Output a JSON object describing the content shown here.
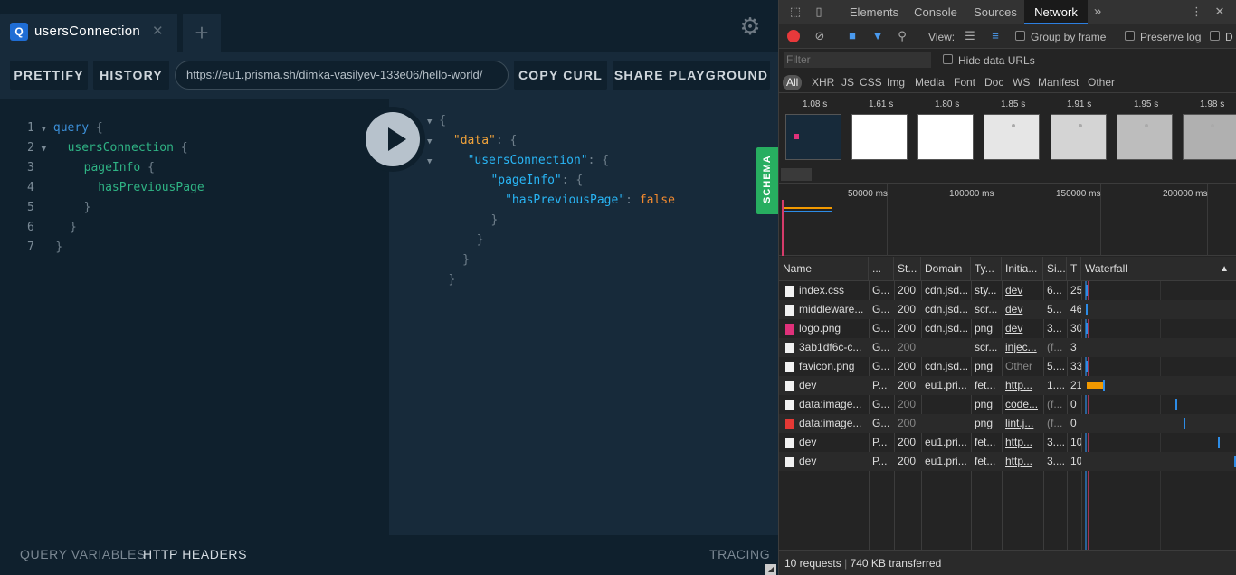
{
  "playground": {
    "tab": {
      "badge": "Q",
      "title": "usersConnection",
      "close": "✕"
    },
    "add_tab": "+",
    "toolbar": {
      "prettify": "PRETTIFY",
      "history": "HISTORY",
      "url": "https://eu1.prisma.sh/dimka-vasilyev-133e06/hello-world/",
      "copy_curl": "COPY CURL",
      "share": "SHARE PLAYGROUND"
    },
    "editor_lines": [
      {
        "n": "1",
        "text": "query {"
      },
      {
        "n": "2",
        "text": "usersConnection {"
      },
      {
        "n": "3",
        "text": "pageInfo {"
      },
      {
        "n": "4",
        "text": "hasPreviousPage"
      },
      {
        "n": "5",
        "text": "}"
      },
      {
        "n": "6",
        "text": "}"
      },
      {
        "n": "7",
        "text": "}"
      }
    ],
    "result": {
      "open": "{",
      "data_key": "\"data\"",
      "conn_key": "\"usersConnection\"",
      "page_key": "\"pageInfo\"",
      "prev_key": "\"hasPreviousPage\"",
      "prev_value": "false",
      "colon_brace": ": {",
      "colon": ": ",
      "close": "}"
    },
    "schema": "SCHEMA",
    "bottom": {
      "query_vars": "QUERY VARIABLES",
      "http_headers": "HTTP HEADERS",
      "tracing": "TRACING"
    }
  },
  "devtools": {
    "tabs": [
      "Elements",
      "Console",
      "Sources",
      "Network"
    ],
    "active_tab": "Network",
    "more": "»",
    "controls": {
      "view": "View:",
      "group_by_frame": "Group by frame",
      "preserve_log": "Preserve log",
      "disable_cache": "D"
    },
    "filter_placeholder": "Filter",
    "hide_data_urls": "Hide data URLs",
    "types": [
      "All",
      "XHR",
      "JS",
      "CSS",
      "Img",
      "Media",
      "Font",
      "Doc",
      "WS",
      "Manifest",
      "Other"
    ],
    "filmstrip_times": [
      "1.08 s",
      "1.61 s",
      "1.80 s",
      "1.85 s",
      "1.91 s",
      "1.95 s",
      "1.98 s"
    ],
    "overview_labels": [
      "50000 ms",
      "100000 ms",
      "150000 ms",
      "200000 ms"
    ],
    "columns": [
      "Name",
      "...",
      "St...",
      "Domain",
      "Ty...",
      "Initia...",
      "Si...",
      "T",
      "Waterfall"
    ],
    "rows": [
      {
        "name": "index.css",
        "method": "G...",
        "status": "200",
        "domain": "cdn.jsd...",
        "type": "sty...",
        "initiator": "dev",
        "size": "6...",
        "time": "25"
      },
      {
        "name": "middleware...",
        "method": "G...",
        "status": "200",
        "domain": "cdn.jsd...",
        "type": "scr...",
        "initiator": "dev",
        "size": "5...",
        "time": "46"
      },
      {
        "name": "logo.png",
        "method": "G...",
        "status": "200",
        "domain": "cdn.jsd...",
        "type": "png",
        "initiator": "dev",
        "size": "3...",
        "time": "30"
      },
      {
        "name": "3ab1df6c-c...",
        "method": "G...",
        "status": "200",
        "domain": "",
        "type": "scr...",
        "initiator": "injec...",
        "size": "(f...",
        "time": "3"
      },
      {
        "name": "favicon.png",
        "method": "G...",
        "status": "200",
        "domain": "cdn.jsd...",
        "type": "png",
        "initiator": "Other",
        "size": "5....",
        "time": "33"
      },
      {
        "name": "dev",
        "method": "P...",
        "status": "200",
        "domain": "eu1.pri...",
        "type": "fet...",
        "initiator": "http...",
        "size": "1....",
        "time": "21"
      },
      {
        "name": "data:image...",
        "method": "G...",
        "status": "200",
        "domain": "",
        "type": "png",
        "initiator": "code...",
        "size": "(f...",
        "time": "0"
      },
      {
        "name": "data:image...",
        "method": "G...",
        "status": "200",
        "domain": "",
        "type": "png",
        "initiator": "lint.j...",
        "size": "(f...",
        "time": "0"
      },
      {
        "name": "dev",
        "method": "P...",
        "status": "200",
        "domain": "eu1.pri...",
        "type": "fet...",
        "initiator": "http...",
        "size": "3....",
        "time": "10"
      },
      {
        "name": "dev",
        "method": "P...",
        "status": "200",
        "domain": "eu1.pri...",
        "type": "fet...",
        "initiator": "http...",
        "size": "3....",
        "time": "10"
      }
    ],
    "status": {
      "requests": "10 requests",
      "sep": "|",
      "transferred": "740 KB transferred"
    }
  }
}
